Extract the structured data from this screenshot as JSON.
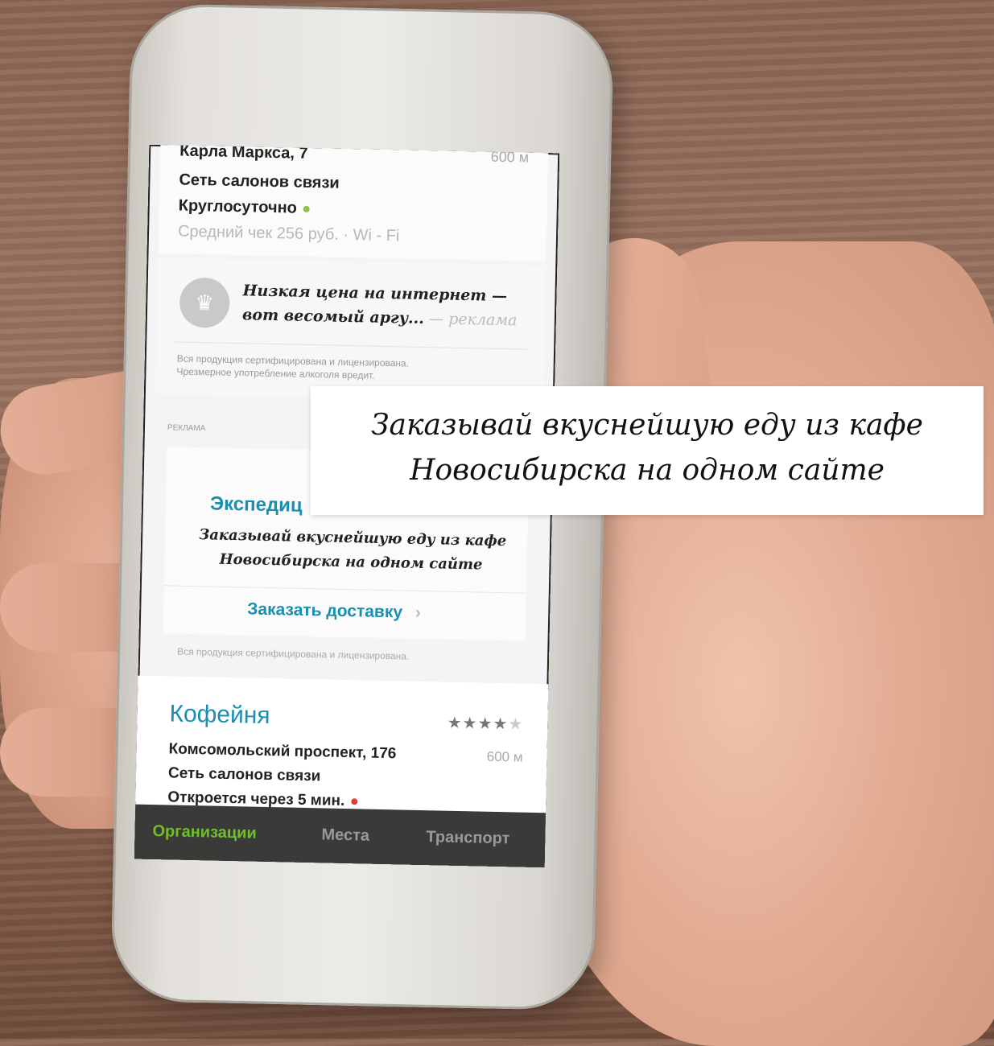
{
  "colors": {
    "accent_green": "#6fbf2c",
    "accent_blue": "#1a8fb2",
    "open_dot": "#8bc34a",
    "closed_dot": "#e53935"
  },
  "top_card": {
    "address_cut": "Карла Маркса, 7",
    "distance_cut": "600 м",
    "category": "Сеть салонов связи",
    "hours": "Круглосуточно",
    "details": "Средний чек 256 руб. · Wi - Fi"
  },
  "ad_card": {
    "icon": "crown-icon",
    "text_line1": "Низкая цена на интернет —",
    "text_line2": "вот весомый аргу...",
    "ad_label": "— реклама",
    "disclaimer_line1": "Вся продукция сертифицирована  и лицензирована.",
    "disclaimer_line2": "Чрезмерное употребление алкоголя вредит."
  },
  "promo": {
    "section_label": "РЕКЛАМА",
    "title": "Экспедиц",
    "text_line1": "Заказывай вкуснейшую еду из кафе",
    "text_line2": "Новосибирска на одном сайте",
    "cta": "Заказать доставку",
    "cta_icon": "chevron-right-icon",
    "disclaimer": "Вся продукция сертифицирована  и лицензирована."
  },
  "listing": {
    "name": "Кофейня",
    "rating": 4,
    "rating_max": 5,
    "address": "Комсомольский проспект, 176",
    "distance": "600 м",
    "category": "Сеть салонов связи",
    "status": "Откроется через 5 мин."
  },
  "tabs": [
    "Организации",
    "Места",
    "Транспорт"
  ],
  "banner": {
    "line1": "Заказывай вкуснейшую еду из кафе",
    "line2": "Новосибирска на одном сайте"
  }
}
